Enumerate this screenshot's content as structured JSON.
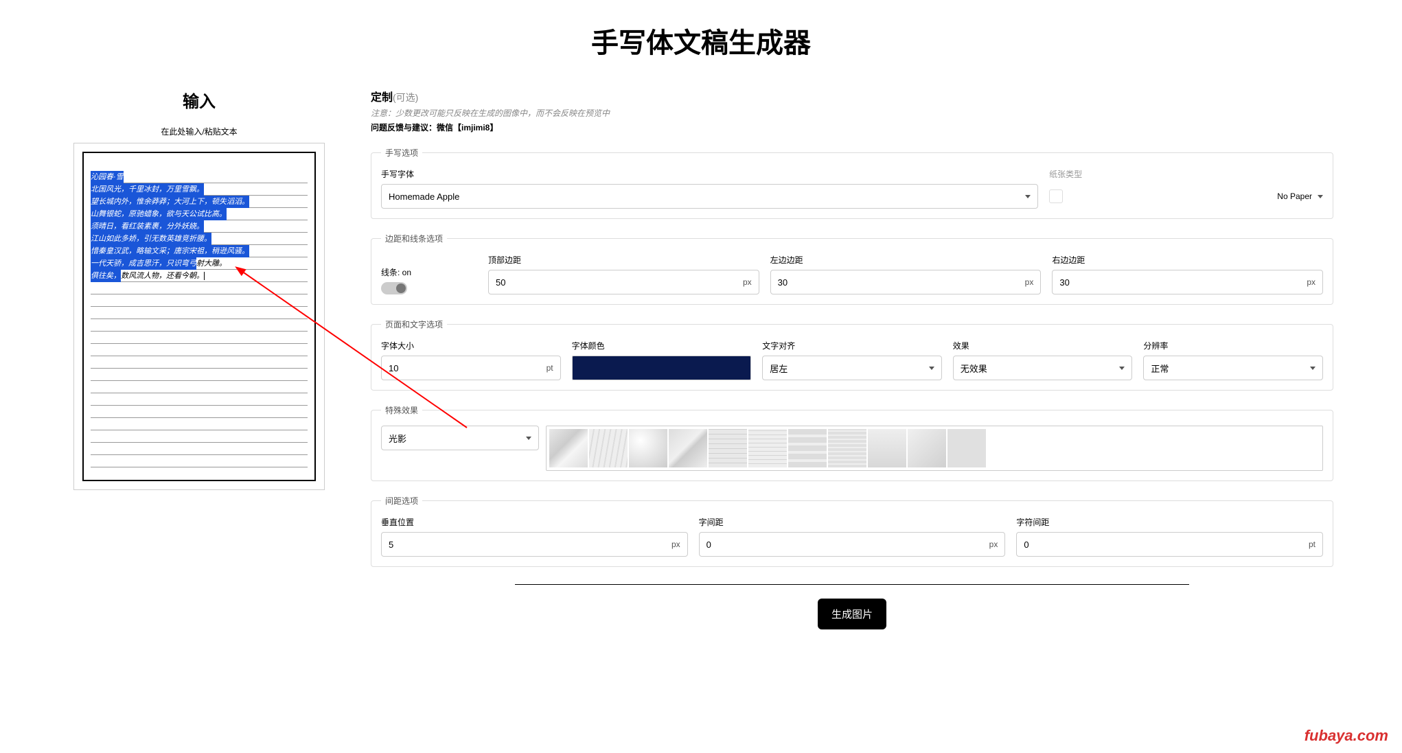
{
  "header": {
    "title": "手写体文稿生成器"
  },
  "input": {
    "heading": "输入",
    "hint": "在此处输入/粘贴文本",
    "poem_lines": [
      {
        "selected": "沁园春·雪",
        "rest": ""
      },
      {
        "selected": "北国风光，千里冰封，万里雪飘。",
        "rest": ""
      },
      {
        "selected": "望长城内外，惟余莽莽；大河上下，顿失滔滔。",
        "rest": ""
      },
      {
        "selected": "山舞银蛇，原驰蜡象，欲与天公试比高。",
        "rest": ""
      },
      {
        "selected": "须晴日，看红装素裹，分外妖娆。",
        "rest": ""
      },
      {
        "selected": "江山如此多娇，引无数英雄竞折腰。",
        "rest": ""
      },
      {
        "selected": "惜秦皇汉武，略输文采；唐宗宋祖，稍逊风骚。",
        "rest": ""
      },
      {
        "selected": "一代天骄，成吉思汗，只识弯弓",
        "rest": "射大雕。"
      },
      {
        "selected": "俱往矣，",
        "rest": "数风流人物，还看今朝。"
      }
    ]
  },
  "customize": {
    "heading": "定制",
    "optional": "(可选)",
    "note": "注意：少数更改可能只反映在生成的图像中，而不会反映在预览中",
    "feedback": "问题反馈与建议：微信【imjimi8】",
    "handwriting": {
      "legend": "手写选项",
      "font_label": "手写字体",
      "font_value": "Homemade Apple",
      "paper_label": "纸张类型",
      "paper_value": "No Paper"
    },
    "margins": {
      "legend": "边距和线条选项",
      "lines_label": "线条: on",
      "top_label": "顶部边距",
      "top_value": "50",
      "top_unit": "px",
      "left_label": "左边边距",
      "left_value": "30",
      "left_unit": "px",
      "right_label": "右边边距",
      "right_value": "30",
      "right_unit": "px"
    },
    "page": {
      "legend": "页面和文字选项",
      "size_label": "字体大小",
      "size_value": "10",
      "size_unit": "pt",
      "color_label": "字体颜色",
      "align_label": "文字对齐",
      "align_value": "居左",
      "effect_label": "效果",
      "effect_value": "无效果",
      "res_label": "分辨率",
      "res_value": "正常"
    },
    "special": {
      "legend": "特殊效果",
      "type_value": "光影"
    },
    "spacing": {
      "legend": "间距选项",
      "vert_label": "垂直位置",
      "vert_value": "5",
      "vert_unit": "px",
      "word_label": "字间距",
      "word_value": "0",
      "word_unit": "px",
      "char_label": "字符间距",
      "char_value": "0",
      "char_unit": "pt"
    }
  },
  "generate_label": "生成图片",
  "watermark": "fubaya.com"
}
